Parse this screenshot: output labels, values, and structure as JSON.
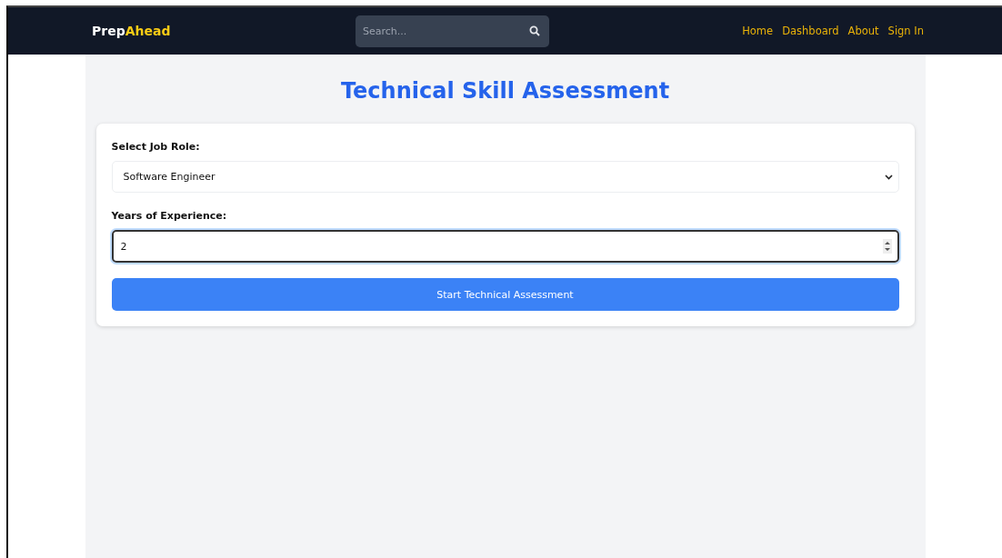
{
  "navbar": {
    "brand": [
      "Prep",
      "Ahead"
    ],
    "search": {
      "placeholder": "Search..."
    },
    "links": [
      "Home",
      "Dashboard",
      "About",
      "Sign In"
    ]
  },
  "title": "Technical Skill Assessment",
  "form": {
    "job_role": {
      "label": "Select Job Role:",
      "value": "Software Engineer"
    },
    "experience": {
      "label": "Years of Experience:",
      "value": "2",
      "focused": true
    },
    "submit": "Start Technical Assessment"
  }
}
